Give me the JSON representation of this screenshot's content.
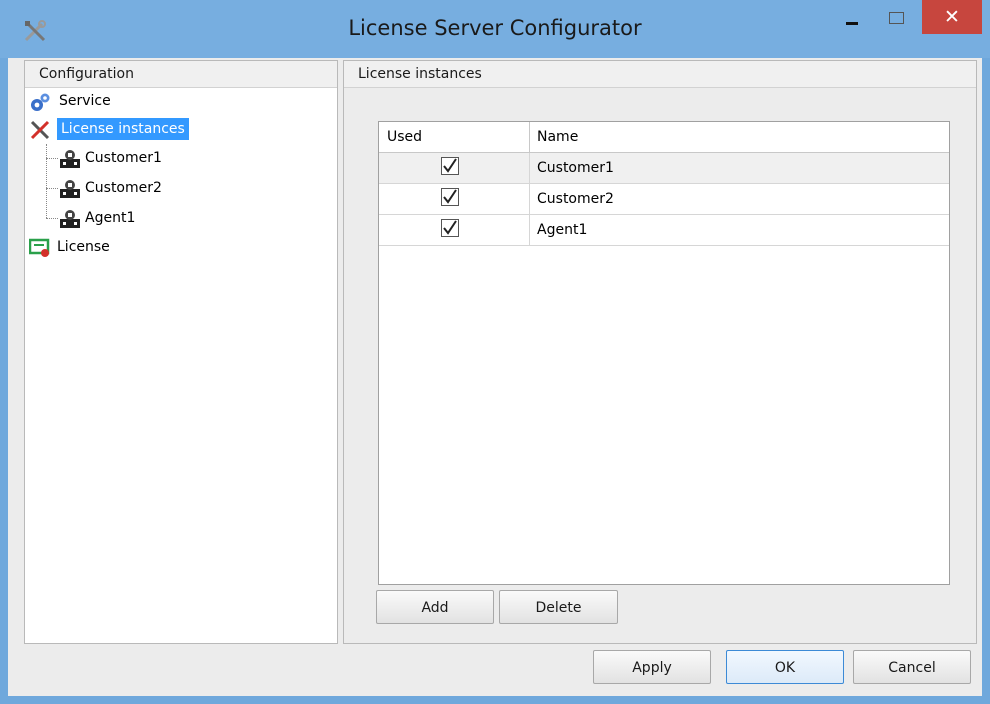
{
  "window": {
    "title": "License Server Configurator",
    "close_glyph": "✕",
    "app_icon": "tools-icon",
    "accent": "#77aee0"
  },
  "left_panel": {
    "header": "Configuration",
    "tree": [
      {
        "label": "Service",
        "icon": "gears-icon"
      },
      {
        "label": "License instances",
        "icon": "wrench-screwdriver-icon",
        "selected": true
      },
      {
        "label": "Customer1",
        "icon": "license-instance-icon"
      },
      {
        "label": "Customer2",
        "icon": "license-instance-icon"
      },
      {
        "label": "Agent1",
        "icon": "license-instance-icon"
      },
      {
        "label": "License",
        "icon": "certificate-icon"
      }
    ]
  },
  "right_panel": {
    "header": "License instances",
    "grid": {
      "columns": [
        "Used",
        "Name"
      ],
      "rows": [
        {
          "used": true,
          "name": "Customer1"
        },
        {
          "used": true,
          "name": "Customer2"
        },
        {
          "used": true,
          "name": "Agent1"
        }
      ]
    },
    "buttons": {
      "add": "Add",
      "delete": "Delete"
    }
  },
  "footer": {
    "apply": "Apply",
    "ok": "OK",
    "cancel": "Cancel"
  }
}
